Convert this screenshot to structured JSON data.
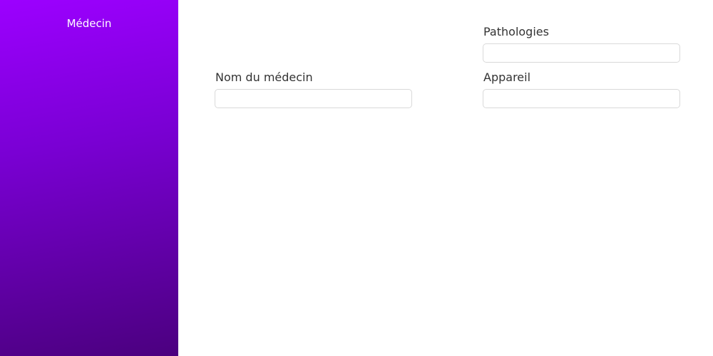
{
  "sidebar": {
    "title": "Médecin"
  },
  "form": {
    "nom_medecin": {
      "label": "Nom du médecin",
      "value": ""
    },
    "pathologies": {
      "label": "Pathologies",
      "value": ""
    },
    "appareil": {
      "label": "Appareil",
      "value": ""
    }
  },
  "colors": {
    "sidebar_gradient_top": "#9c00ff",
    "sidebar_gradient_bottom": "#4b007f"
  }
}
